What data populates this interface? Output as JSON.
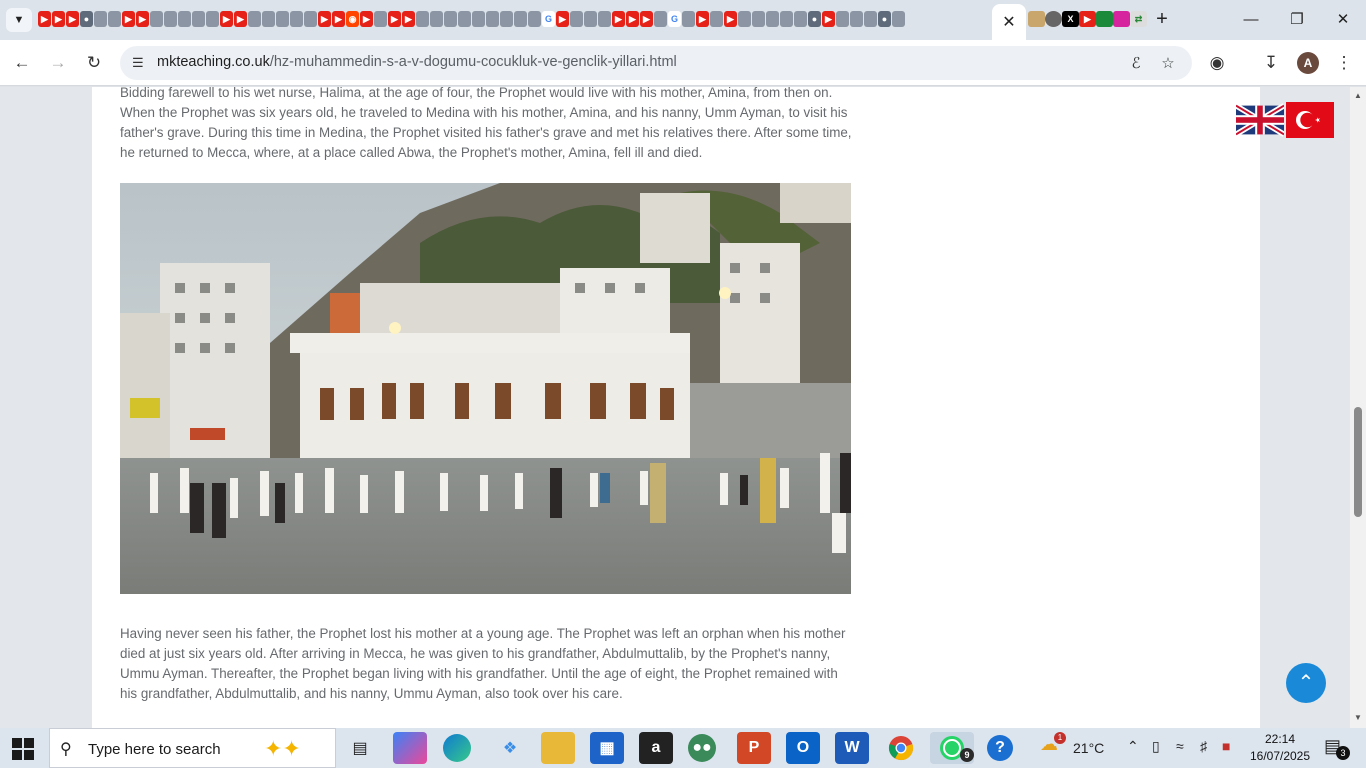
{
  "browser": {
    "url_host": "mkteaching.co.uk",
    "url_path": "/hz-muhammedin-s-a-v-dogumu-cocukluk-ve-genclik-yillari.html",
    "profile_initial": "A",
    "tab_favicons": [
      "youtube",
      "youtube",
      "youtube",
      "globe",
      "generic",
      "generic",
      "youtube",
      "youtube",
      "generic",
      "generic",
      "generic",
      "generic",
      "generic",
      "youtube",
      "youtube",
      "generic",
      "generic",
      "generic",
      "generic",
      "generic",
      "youtube",
      "youtube",
      "reddit",
      "youtube",
      "generic",
      "youtube",
      "youtube",
      "generic",
      "generic",
      "generic",
      "generic",
      "generic",
      "generic",
      "generic",
      "generic",
      "generic",
      "google",
      "youtube",
      "generic",
      "generic",
      "generic",
      "youtube",
      "youtube",
      "youtube",
      "generic",
      "google",
      "generic",
      "youtube",
      "generic",
      "youtube",
      "generic",
      "generic",
      "generic",
      "generic",
      "generic",
      "globe",
      "youtube",
      "generic",
      "generic",
      "generic",
      "globe",
      "generic"
    ]
  },
  "article": {
    "para1": "Bidding farewell to his wet nurse, Halima, at the age of four, the Prophet would live with his mother, Amina, from then on. When the Prophet was six years old, he traveled to Medina with his mother, Amina, and his nanny, Umm Ayman, to visit his father's grave. During this time in Medina, the Prophet visited his father's grave and met his relatives there. After some time, he returned to Mecca, where, at a place called Abwa, the Prophet's mother, Amina, fell ill and died.",
    "para2": "Having never seen his father, the Prophet lost his mother at a young age. The Prophet was left an orphan when his mother died at just six years old. After arriving in Mecca, he was given to his grandfather, Abdulmuttalib, by the Prophet's nanny, Ummu Ayman. Thereafter, the Prophet began living with his grandfather. Until the age of eight, the Prophet remained with his grandfather, Abdulmuttalib, and his nanny, Ummu Ayman, also took over his care."
  },
  "taskbar": {
    "search_placeholder": "Type here to search",
    "whatsapp_badge": "9",
    "weather_badge": "1",
    "temperature": "21°C",
    "notifications_badge": "3",
    "time": "22:14",
    "date": "16/07/2025"
  },
  "colors": {
    "accent": "#1a8ad8",
    "youtube": "#e62117",
    "text": "#666a6e"
  }
}
